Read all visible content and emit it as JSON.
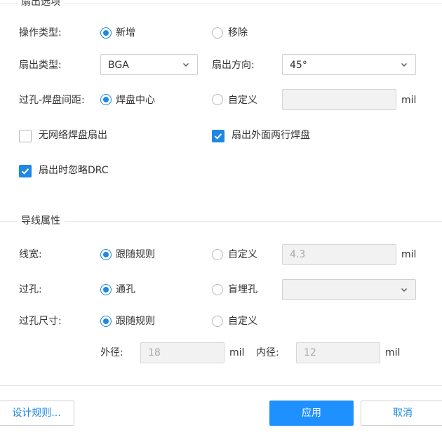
{
  "fanout": {
    "legend": "扇出选项",
    "op_type": {
      "label": "操作类型:",
      "options": [
        "新增",
        "移除"
      ],
      "selected": 0
    },
    "fanout_type": {
      "label": "扇出类型:",
      "value": "BGA"
    },
    "fanout_direction": {
      "label": "扇出方向:",
      "value": "45°"
    },
    "via_pad_spacing": {
      "label": "过孔-焊盘间距:",
      "options": [
        "焊盘中心",
        "自定义"
      ],
      "selected": 0,
      "input_value": "",
      "unit": "mil"
    },
    "no_net_pad_fanout": {
      "label": "无网络焊盘扇出",
      "checked": false
    },
    "outer_two_rows": {
      "label": "扇出外面两行焊盘",
      "checked": true
    },
    "ignore_drc": {
      "label": "扇出时忽略DRC",
      "checked": true
    }
  },
  "wire": {
    "legend": "导线属性",
    "width": {
      "label": "线宽:",
      "options": [
        "跟随规则",
        "自定义"
      ],
      "selected": 0,
      "input_value": "4.3",
      "unit": "mil"
    },
    "via": {
      "label": "过孔:",
      "options": [
        "通孔",
        "盲埋孔"
      ],
      "selected": 0,
      "select_value": ""
    },
    "via_size": {
      "label": "过孔尺寸:",
      "options": [
        "跟随规则",
        "自定义"
      ],
      "selected": 0,
      "outer_label": "外径:",
      "outer_value": "18",
      "outer_unit": "mil",
      "inner_label": "内径:",
      "inner_value": "12",
      "inner_unit": "mil"
    }
  },
  "footer": {
    "design_rules": "设计规则...",
    "apply": "应用",
    "cancel": "取消"
  },
  "colors": {
    "accent": "#1e88e5",
    "primary_button": "#1e90ff",
    "disabled_bg": "#f2f2f2"
  }
}
